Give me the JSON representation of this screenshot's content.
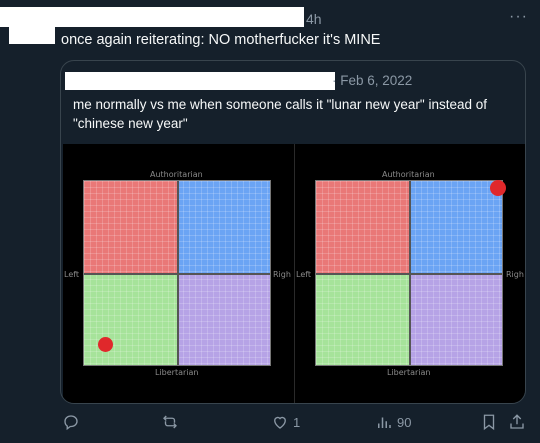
{
  "tweet": {
    "time": "4h",
    "text": "once again reiterating: NO motherfucker it's MINE",
    "more": "···"
  },
  "quote": {
    "date": "· Feb 6, 2022",
    "text": "me normally vs me when someone calls it \"lunar new year\" instead of \"chinese new year\""
  },
  "compass": {
    "top": "Authoritarian",
    "bottom": "Libertarian",
    "left": "Left",
    "right": "Righ",
    "colors": {
      "auth_left": "#e97877",
      "auth_right": "#6ba4f4",
      "lib_left": "#a6e39a",
      "lib_right": "#b6a3e6",
      "dot": "#e0282b"
    }
  },
  "actions": {
    "reply_count": "",
    "retweet_count": "",
    "like_count": "1",
    "views_count": "90"
  }
}
